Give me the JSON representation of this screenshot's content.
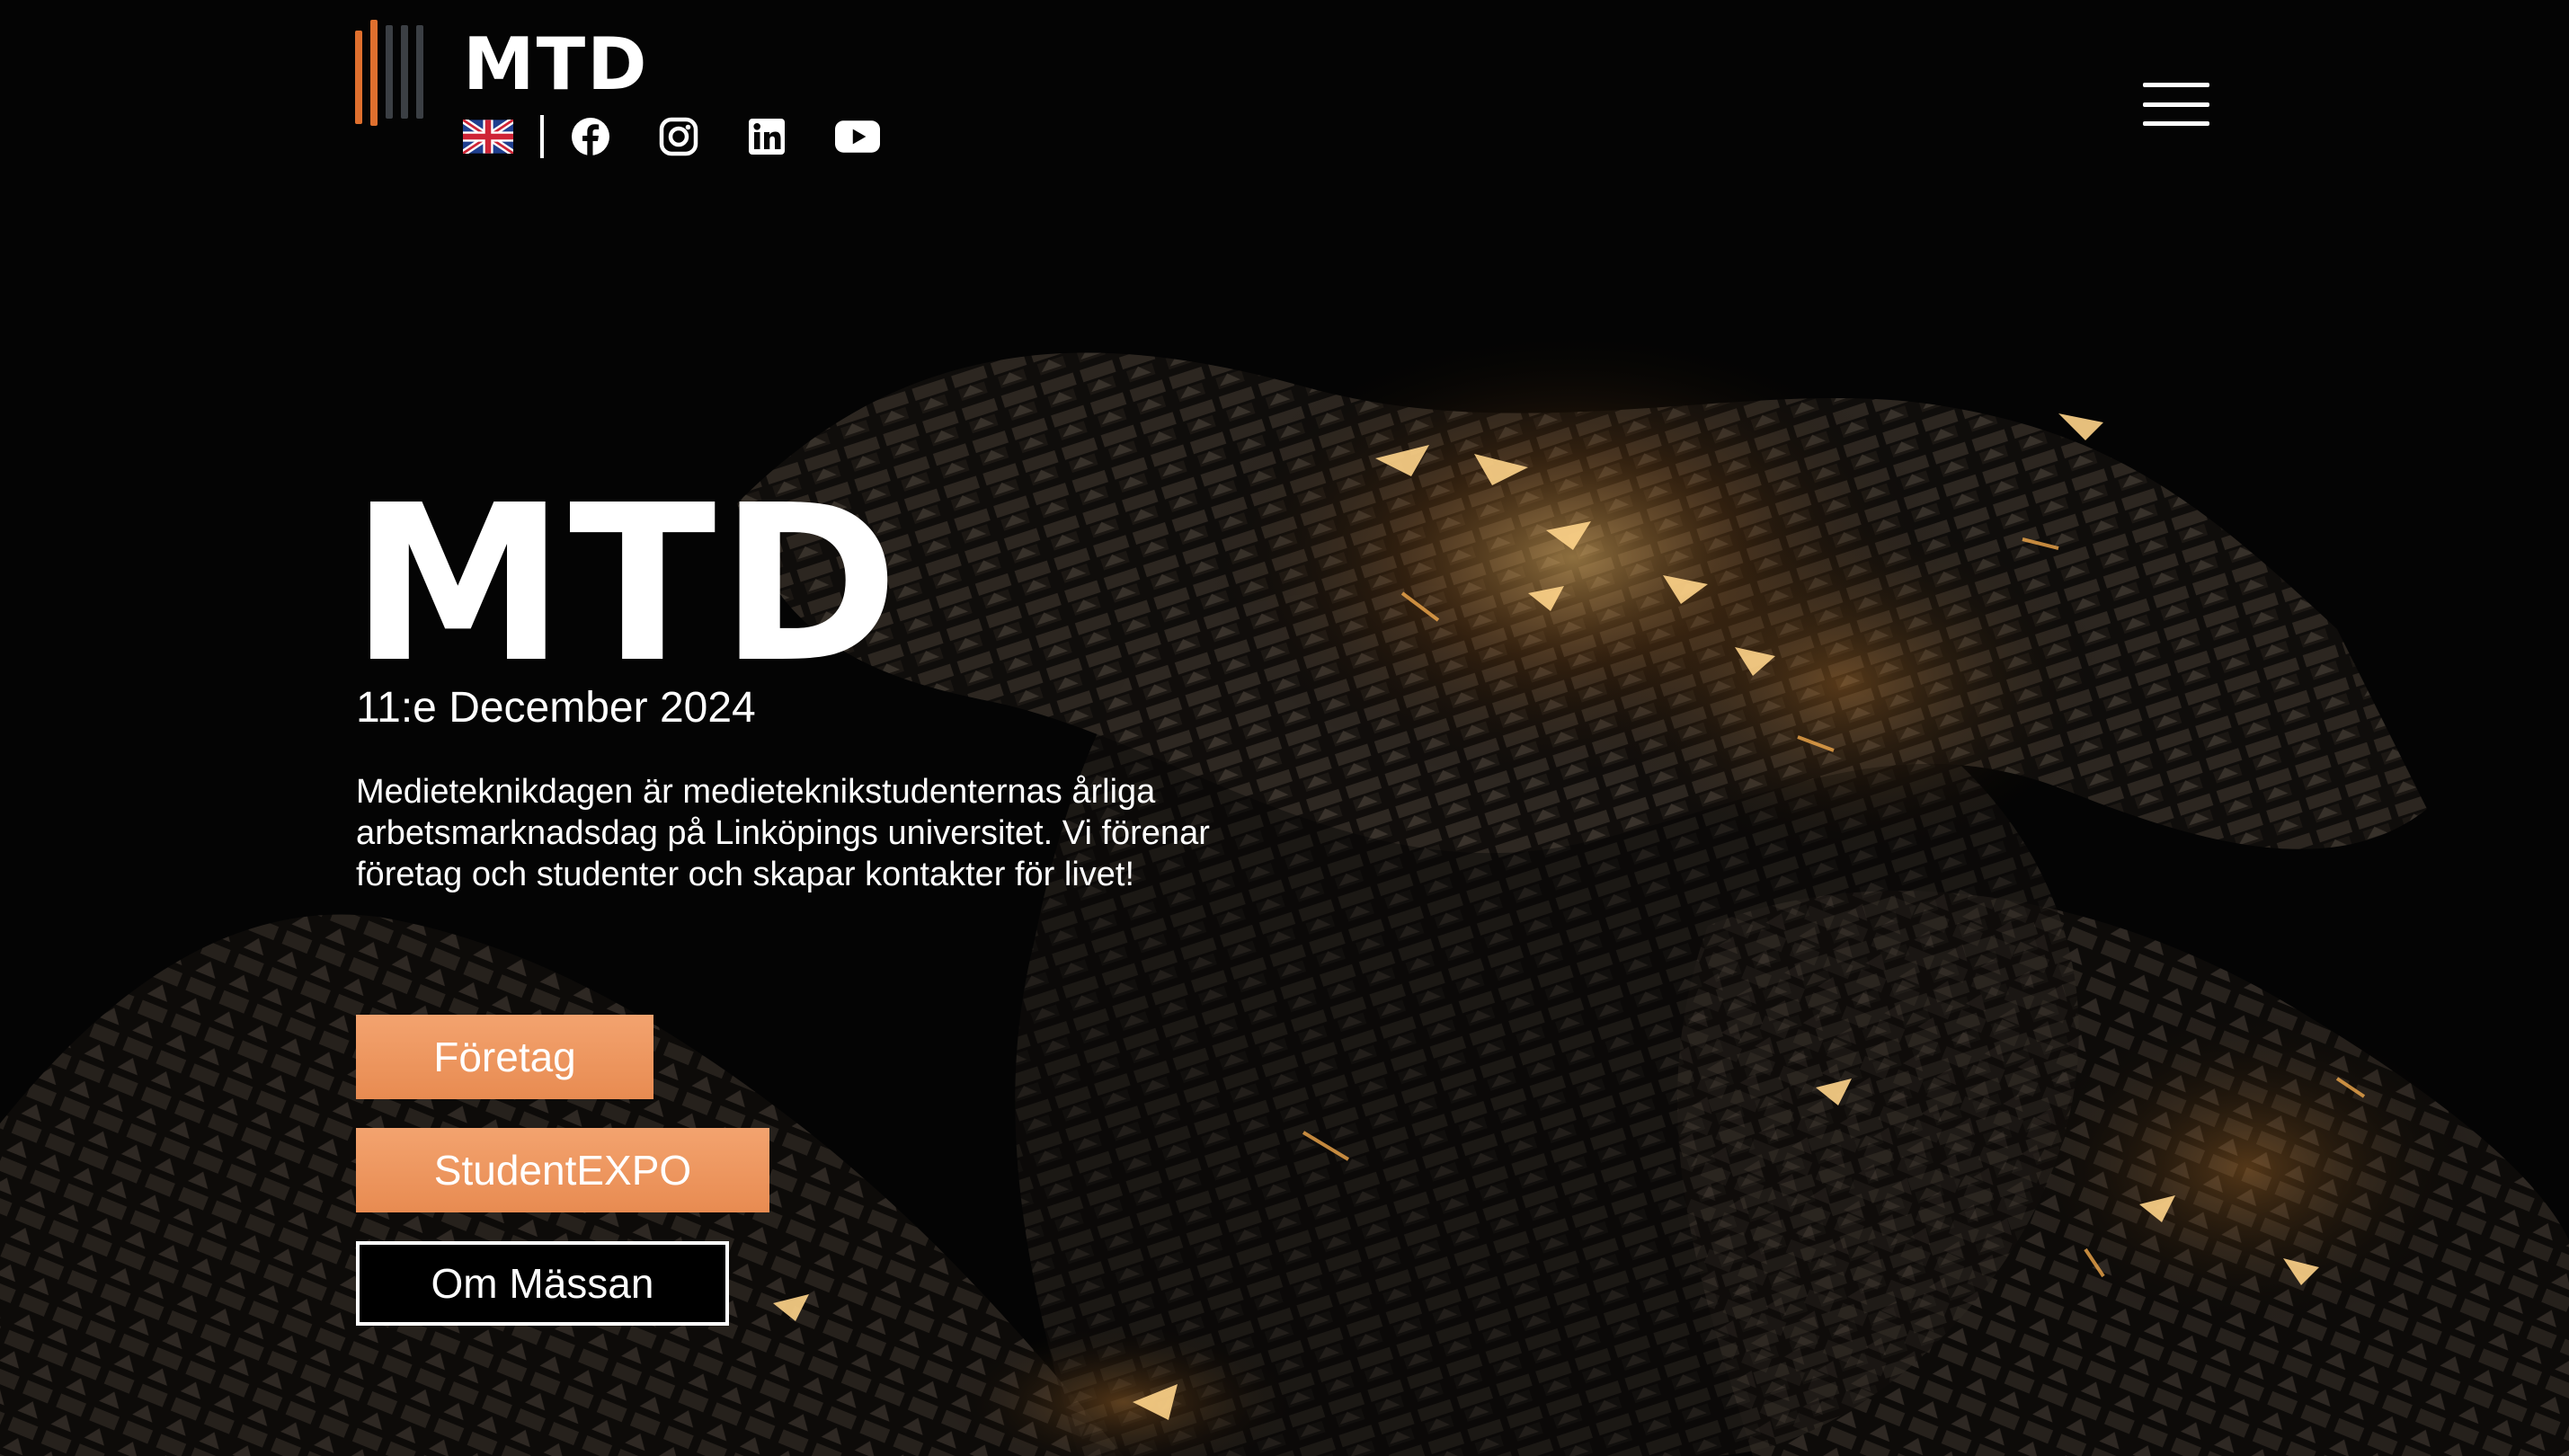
{
  "brand": {
    "logo_text": "MTD",
    "logo_bar_colors": [
      "#e0702e",
      "#e0702e",
      "#3b3f44",
      "#3b3f44",
      "#3b3f44"
    ]
  },
  "header": {
    "language_flag": "uk-flag-icon",
    "social_icons": [
      "facebook-icon",
      "instagram-icon",
      "linkedin-icon",
      "youtube-icon"
    ],
    "menu_icon": "hamburger-menu-icon"
  },
  "hero": {
    "title": "MTD",
    "date": "11:e December 2024",
    "description": "Medieteknikdagen är medieteknikstudenternas årliga arbetsmarknadsdag på Linköpings universitet. Vi förenar företag och studenter och skapar kontakter för livet!"
  },
  "buttons": {
    "foretag": "Företag",
    "student_expo": "StudentEXPO",
    "om_massan": "Om Mässan"
  },
  "colors": {
    "accent_orange": "#ef9a63",
    "logo_orange": "#e0702e",
    "background": "#050505"
  }
}
